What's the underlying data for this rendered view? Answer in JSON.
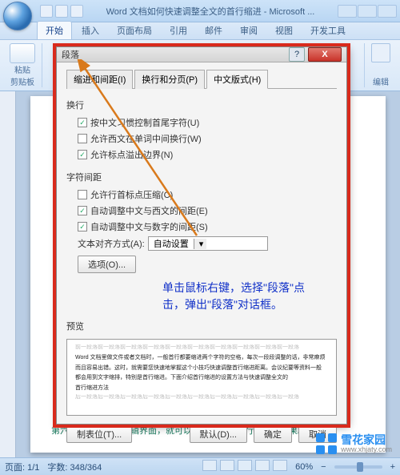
{
  "window": {
    "title": "Word 文档如何快速调整全文的首行缩进 - Microsoft ..."
  },
  "ribbon": {
    "tabs": [
      "开始",
      "插入",
      "页面布局",
      "引用",
      "邮件",
      "审阅",
      "视图",
      "开发工具"
    ],
    "clipboard_label": "剪贴板",
    "paste_label": "粘贴",
    "edit_label": "编辑"
  },
  "body_text": "第六步：回到文档编辑界面，就可以看见全文的首行缩进的效果。",
  "dialog": {
    "title": "段落",
    "tabs": [
      "缩进和间距(I)",
      "换行和分页(P)",
      "中文版式(H)"
    ],
    "section_wrap": "换行",
    "chk1": "按中文习惯控制首尾字符(U)",
    "chk2": "允许西文在单词中间换行(W)",
    "chk3": "允许标点溢出边界(N)",
    "section_spacing": "字符间距",
    "chk4": "允许行首标点压缩(C)",
    "chk5": "自动调整中文与西文的间距(E)",
    "chk6": "自动调整中文与数字的间距(S)",
    "align_label": "文本对齐方式(A):",
    "align_value": "自动设置",
    "options_btn": "选项(O)...",
    "preview_label": "预览",
    "pv_grey": "前一段落前一段落前一段落前一段落前一段落前一段落前一段落前一段落前一段落前一段落",
    "pv_line1": "Word 文档里做文件或者文档时，一般首行都要缩进两个字符的空格，每次一段段调整的话，非常麻烦",
    "pv_line2": "而且容易出错。这时，就需要您快速地掌握这个小技巧快速调整首行缩进距离。会议纪要等资料一般",
    "pv_line3": "都会用到文字缩排，特别是首行缩进。下面介绍首行缩进的设置方法与快速调整全文的",
    "pv_line4": "首行缩进方法",
    "pv_grey2": "后一段落后一段落后一段落后一段落后一段落后一段落后一段落后一段落后一段落后一段落",
    "tab_btn": "制表位(T)...",
    "default_btn": "默认(D)...",
    "ok_btn": "确定",
    "cancel_btn": "取消"
  },
  "annotation": "单击鼠标右键，选择\"段落\"点击，弹出\"段落\"对话框。",
  "status": {
    "page": "页面: 1/1",
    "words": "字数: 348/364",
    "zoom": "60%"
  },
  "watermark": {
    "name": "雪花家园",
    "url": "www.xhjaty.com"
  }
}
